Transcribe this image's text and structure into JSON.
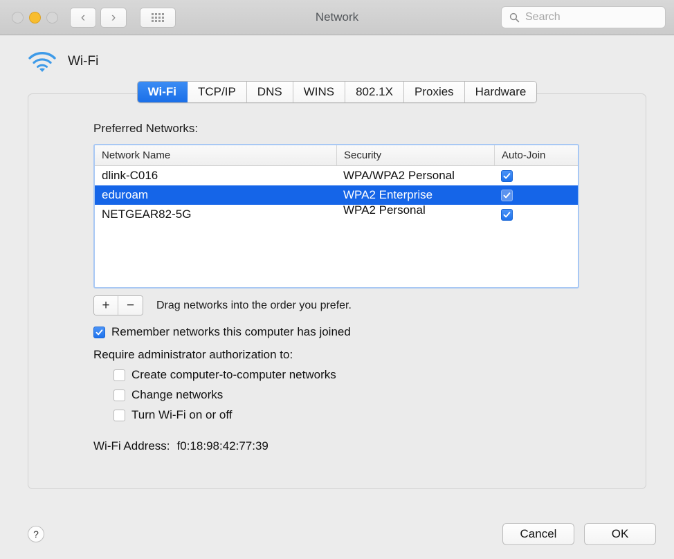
{
  "window": {
    "title": "Network",
    "traffic_lights": [
      "close",
      "minimize",
      "zoom"
    ]
  },
  "toolbar": {
    "back_glyph": "‹",
    "forward_glyph": "›",
    "grid_icon": "show-all-icon",
    "search": {
      "placeholder": "Search",
      "value": "",
      "icon": "search-icon"
    }
  },
  "service": {
    "icon": "wifi-icon",
    "name": "Wi-Fi"
  },
  "tabs": [
    {
      "label": "Wi-Fi",
      "active": true
    },
    {
      "label": "TCP/IP",
      "active": false
    },
    {
      "label": "DNS",
      "active": false
    },
    {
      "label": "WINS",
      "active": false
    },
    {
      "label": "802.1X",
      "active": false
    },
    {
      "label": "Proxies",
      "active": false
    },
    {
      "label": "Hardware",
      "active": false
    }
  ],
  "preferred_networks": {
    "label": "Preferred Networks:",
    "columns": [
      "Network Name",
      "Security",
      "Auto-Join"
    ],
    "rows": [
      {
        "name": "dlink-C016",
        "security": "WPA/WPA2 Personal",
        "auto_join": true,
        "selected": false
      },
      {
        "name": "eduroam",
        "security": "WPA2 Enterprise",
        "auto_join": true,
        "selected": true
      },
      {
        "name": "NETGEAR82-5G",
        "security": "WPA2 Personal",
        "auto_join": true,
        "selected": false
      }
    ]
  },
  "list_controls": {
    "add_label": "+",
    "remove_label": "−",
    "hint": "Drag networks into the order you prefer."
  },
  "options": {
    "remember": {
      "label": "Remember networks this computer has joined",
      "checked": true
    },
    "require_admin_label": "Require administrator authorization to:",
    "admin_items": [
      {
        "label": "Create computer-to-computer networks",
        "checked": false
      },
      {
        "label": "Change networks",
        "checked": false
      },
      {
        "label": "Turn Wi-Fi on or off",
        "checked": false
      }
    ]
  },
  "wifi_address": {
    "label": "Wi-Fi Address:",
    "value": "f0:18:98:42:77:39"
  },
  "footer": {
    "help_label": "?",
    "cancel_label": "Cancel",
    "ok_label": "OK"
  },
  "colors": {
    "accent_blue": "#1565e8",
    "tab_active_blue": "#1a6fe8",
    "focus_ring": "#a8c8f4",
    "window_bg": "#ececec",
    "panel_bg": "#ebebeb",
    "amber": "#f8bd2e"
  }
}
